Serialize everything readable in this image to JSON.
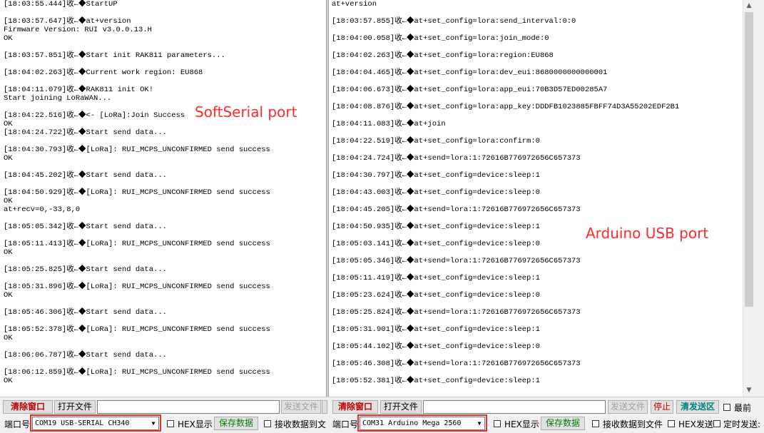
{
  "left_log": {
    "lines": [
      "[18:03:55.444]收←◆StartUP",
      "",
      "[18:03:57.647]收←◆at+version",
      "Firmware Version: RUI v3.0.0.13.H",
      "OK",
      "",
      "[18:03:57.851]收←◆Start init RAK811 parameters...",
      "",
      "[18:04:02.263]收←◆Current work region: EU868",
      "",
      "[18:04:11.079]收←◆RAK811 init OK!",
      "Start joining LoRaWAN...",
      "",
      "[18:04:22.516]收←◆<- [LoRa]:Join Success",
      "OK",
      "[18:04:24.722]收←◆Start send data...",
      "",
      "[18:04:30.793]收←◆[LoRa]: RUI_MCPS_UNCONFIRMED send success",
      "OK",
      "",
      "[18:04:45.202]收←◆Start send data...",
      "",
      "[18:04:50.929]收←◆[LoRa]: RUI_MCPS_UNCONFIRMED send success",
      "OK",
      "at+recv=0,-33,8,0",
      "",
      "[18:05:05.342]收←◆Start send data...",
      "",
      "[18:05:11.413]收←◆[LoRa]: RUI_MCPS_UNCONFIRMED send success",
      "OK",
      "",
      "[18:05:25.825]收←◆Start send data...",
      "",
      "[18:05:31.896]收←◆[LoRa]: RUI_MCPS_UNCONFIRMED send success",
      "OK",
      "",
      "[18:05:46.306]收←◆Start send data...",
      "",
      "[18:05:52.378]收←◆[LoRa]: RUI_MCPS_UNCONFIRMED send success",
      "OK",
      "",
      "[18:06:06.787]收←◆Start send data...",
      "",
      "[18:06:12.859]收←◆[LoRa]: RUI_MCPS_UNCONFIRMED send success",
      "OK"
    ]
  },
  "right_log": {
    "lines": [
      "at+version",
      "",
      "[18:03:57.855]收←◆at+set_config=lora:send_interval:0:0",
      "",
      "[18:04:00.058]收←◆at+set_config=lora:join_mode:0",
      "",
      "[18:04:02.263]收←◆at+set_config=lora:region:EU868",
      "",
      "[18:04:04.465]收←◆at+set_config=lora:dev_eui:8680000000000001",
      "",
      "[18:04:06.673]收←◆at+set_config=lora:app_eui:70B3D57ED00285A7",
      "",
      "[18:04:08.876]收←◆at+set_config=lora:app_key:DDDFB1023885FBFF74D3A55202EDF2B1",
      "",
      "[18:04:11.083]收←◆at+join",
      "",
      "[18:04:22.519]收←◆at+set_config=lora:confirm:0",
      "",
      "[18:04:24.724]收←◆at+send=lora:1:72616B776972656C657373",
      "",
      "[18:04:30.797]收←◆at+set_config=device:sleep:1",
      "",
      "[18:04:43.003]收←◆at+set_config=device:sleep:0",
      "",
      "[18:04:45.205]收←◆at+send=lora:1:72616B776972656C657373",
      "",
      "[18:04:50.935]收←◆at+set_config=device:sleep:1",
      "",
      "[18:05:03.141]收←◆at+set_config=device:sleep:0",
      "",
      "[18:05:05.346]收←◆at+send=lora:1:72616B776972656C657373",
      "",
      "[18:05:11.419]收←◆at+set_config=device:sleep:1",
      "",
      "[18:05:23.624]收←◆at+set_config=device:sleep:0",
      "",
      "[18:05:25.824]收←◆at+send=lora:1:72616B776972656C657373",
      "",
      "[18:05:31.901]收←◆at+set_config=device:sleep:1",
      "",
      "[18:05:44.102]收←◆at+set_config=device:sleep:0",
      "",
      "[18:05:46.308]收←◆at+send=lora:1:72616B776972656C657373",
      "",
      "[18:05:52.381]收←◆at+set_config=device:sleep:1"
    ]
  },
  "annotations": {
    "softserial": "SoftSerial port",
    "arduino": "Arduino USB port"
  },
  "left_toolbar": {
    "clear_window": "清除窗口",
    "open_file": "打开文件",
    "send_file": "发送文件",
    "port_label": "端口号",
    "port_value": "COM19 USB-SERIAL CH340",
    "hex_display": "HEX显示",
    "save_data": "保存数据",
    "receive_to_file": "接收数据到文件"
  },
  "right_toolbar": {
    "clear_window": "清除窗口",
    "open_file": "打开文件",
    "send_file": "发送文件",
    "stop": "停止",
    "clear_send": "清发送区",
    "latest": "最前",
    "port_label": "端口号",
    "port_value": "COM31 Arduino Mega 2560",
    "hex_display": "HEX显示",
    "save_data": "保存数据",
    "receive_to_file": "接收数据到文件",
    "hex_send": "HEX发送",
    "timed_send": "定时发送:"
  },
  "colors": {
    "annotation": "#ff2a2a",
    "highlight_box": "#e8312a"
  }
}
